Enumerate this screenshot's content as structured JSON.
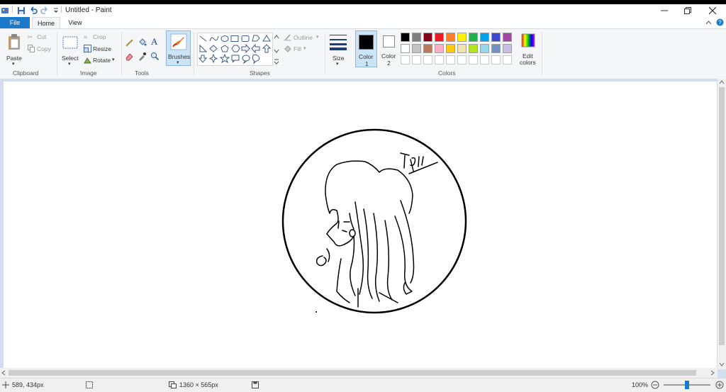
{
  "window": {
    "title": "Untitled - Paint",
    "controls": [
      "minimize",
      "restore",
      "close"
    ]
  },
  "tabs": [
    {
      "label": "File"
    },
    {
      "label": "Home"
    },
    {
      "label": "View"
    }
  ],
  "ribbon": {
    "clipboard": {
      "paste": "Paste",
      "cut": "Cut",
      "copy": "Copy",
      "group": "Clipboard"
    },
    "image": {
      "select": "Select",
      "crop": "Crop",
      "resize": "Resize",
      "rotate": "Rotate",
      "group": "Image"
    },
    "tools": {
      "group": "Tools"
    },
    "brushes": {
      "label": "Brushes"
    },
    "shapes": {
      "outline": "Outline",
      "fill": "Fill",
      "group": "Shapes"
    },
    "size": {
      "label": "Size"
    },
    "color1": {
      "label": "Color",
      "num": "1",
      "value": "#000000"
    },
    "color2": {
      "label": "Color",
      "num": "2",
      "value": "#ffffff"
    },
    "colors": {
      "group": "Colors",
      "edit_line1": "Edit",
      "edit_line2": "colors",
      "row1": [
        "#000000",
        "#7f7f7f",
        "#880015",
        "#ed1c24",
        "#ff7f27",
        "#fff200",
        "#22b14c",
        "#00a2e8",
        "#3f48cc",
        "#a349a4"
      ],
      "row2": [
        "#ffffff",
        "#c3c3c3",
        "#b97a57",
        "#ffaec9",
        "#ffc90e",
        "#efe4b0",
        "#b5e61d",
        "#99d9ea",
        "#7092be",
        "#c8bfe7"
      ],
      "row3": [
        "#ffffff",
        "#ffffff",
        "#ffffff",
        "#ffffff",
        "#ffffff",
        "#ffffff",
        "#ffffff",
        "#ffffff",
        "#ffffff",
        "#ffffff"
      ]
    }
  },
  "canvas": {
    "drawing_text": "1911"
  },
  "status": {
    "cursor": "589, 434px",
    "canvas_size": "1360 × 565px",
    "zoom": "100%",
    "zoom_level": 0.5
  }
}
